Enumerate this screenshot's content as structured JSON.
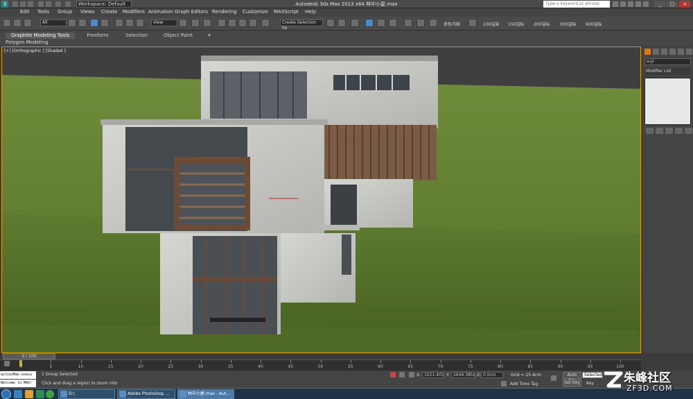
{
  "titlebar": {
    "workspace": "Workspace: Default",
    "window_title": "Autodesk 3ds Max  2013 x64      林中小屋.max",
    "search_placeholder": "Type a keyword or phrase"
  },
  "menu": [
    "Edit",
    "Tools",
    "Group",
    "Views",
    "Create",
    "Modifiers",
    "Animation",
    "Graph Editors",
    "Rendering",
    "Customize",
    "MAXScript",
    "Help"
  ],
  "main_toolbar": {
    "selection_filter": "All",
    "ref_coord": "View",
    "named_selection": "Create Selection Se",
    "custom_buttons": [
      "赤色乌鸦",
      "100渲染",
      "150渲标",
      "200渲标",
      "300渲标",
      "600渲标"
    ]
  },
  "ribbon": {
    "tabs": [
      "Graphite Modeling Tools",
      "Freeform",
      "Selection",
      "Object Paint"
    ],
    "sub_label": "Polygon Modeling"
  },
  "viewport": {
    "label": "[+] [Orthographic ] [Shaded ]"
  },
  "command_panel": {
    "object_name": "a-jz",
    "modifier_list": "Modifier List"
  },
  "timeline": {
    "frame_display": "0 / 100",
    "ticks": [
      "0",
      "5",
      "10",
      "15",
      "20",
      "25",
      "30",
      "35",
      "40",
      "45",
      "50",
      "55",
      "60",
      "65",
      "70",
      "75",
      "80",
      "85",
      "90",
      "95",
      "100"
    ]
  },
  "status": {
    "script_line1": "actionMan.execu",
    "script_line2": "Welcome to MAX!",
    "selection_status": "1 Group Selected",
    "prompt": "Click and drag a region to zoom into",
    "x_label": "X:",
    "x_value": "3221.401",
    "y_label": "Y:",
    "y_value": "2649.385c",
    "z_label": "Z:",
    "z_value": "0.0cm",
    "grid": "Grid = 25.4cm",
    "add_time_tag": "Add Time Tag",
    "auto_key": "Auto Key",
    "set_key": "Set Key",
    "selected_dropdown": "Selected",
    "key_filters": "Key"
  },
  "taskbar": {
    "items": [
      "D:\\",
      "Adobe Photoshop ...",
      "林中小屋.max - Aut..."
    ]
  },
  "watermark": {
    "title": "朱峰社区",
    "url": "ZF3D.COM"
  },
  "colors": {
    "viewport_border": "#d9a400",
    "grass": "#6d8a3c",
    "concrete": "#c9c9c9",
    "wood": "#6b4a36"
  }
}
